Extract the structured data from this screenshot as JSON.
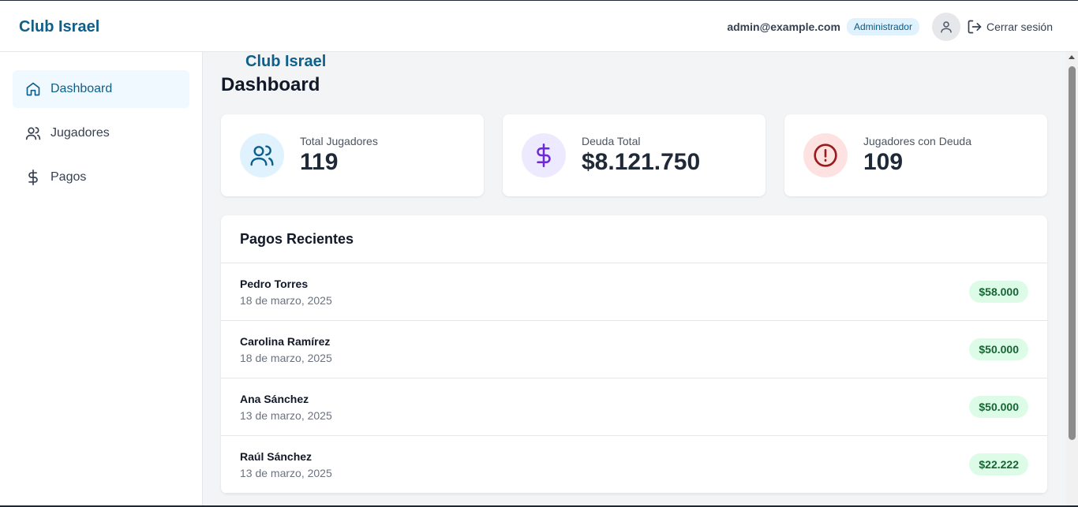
{
  "header": {
    "brand_left": "Club Israel",
    "brand_main": "Club Israel",
    "user_email": "admin@example.com",
    "role": "Administrador",
    "avatar_icon": "user-icon",
    "logout_label": "Cerrar sesión",
    "logout_icon": "logout-icon"
  },
  "sidebar": {
    "items": [
      {
        "label": "Dashboard",
        "icon": "home-icon",
        "active": true
      },
      {
        "label": "Jugadores",
        "icon": "users-icon",
        "active": false
      },
      {
        "label": "Pagos",
        "icon": "dollar-icon",
        "active": false
      }
    ]
  },
  "main": {
    "title": "Dashboard",
    "stats": [
      {
        "label": "Total Jugadores",
        "value": "119",
        "icon": "users-icon",
        "color": "#0e5f8a",
        "bg": "#e0f2fe"
      },
      {
        "label": "Deuda Total",
        "value": "$8.121.750",
        "icon": "dollar-icon",
        "color": "#6d28d9",
        "bg": "#ede9fe"
      },
      {
        "label": "Jugadores con Deuda",
        "value": "109",
        "icon": "alert-circle-icon",
        "color": "#991b1b",
        "bg": "#fee2e2"
      }
    ],
    "payments": {
      "title": "Pagos Recientes",
      "rows": [
        {
          "name": "Pedro Torres",
          "date": "18 de marzo, 2025",
          "amount": "$58.000"
        },
        {
          "name": "Carolina Ramírez",
          "date": "18 de marzo, 2025",
          "amount": "$50.000"
        },
        {
          "name": "Ana Sánchez",
          "date": "13 de marzo, 2025",
          "amount": "$50.000"
        },
        {
          "name": "Raúl Sánchez",
          "date": "13 de marzo, 2025",
          "amount": "$22.222"
        }
      ]
    }
  },
  "colors": {
    "brand": "#0e5f8a",
    "success_bg": "#dcfce7",
    "success_text": "#166534"
  }
}
